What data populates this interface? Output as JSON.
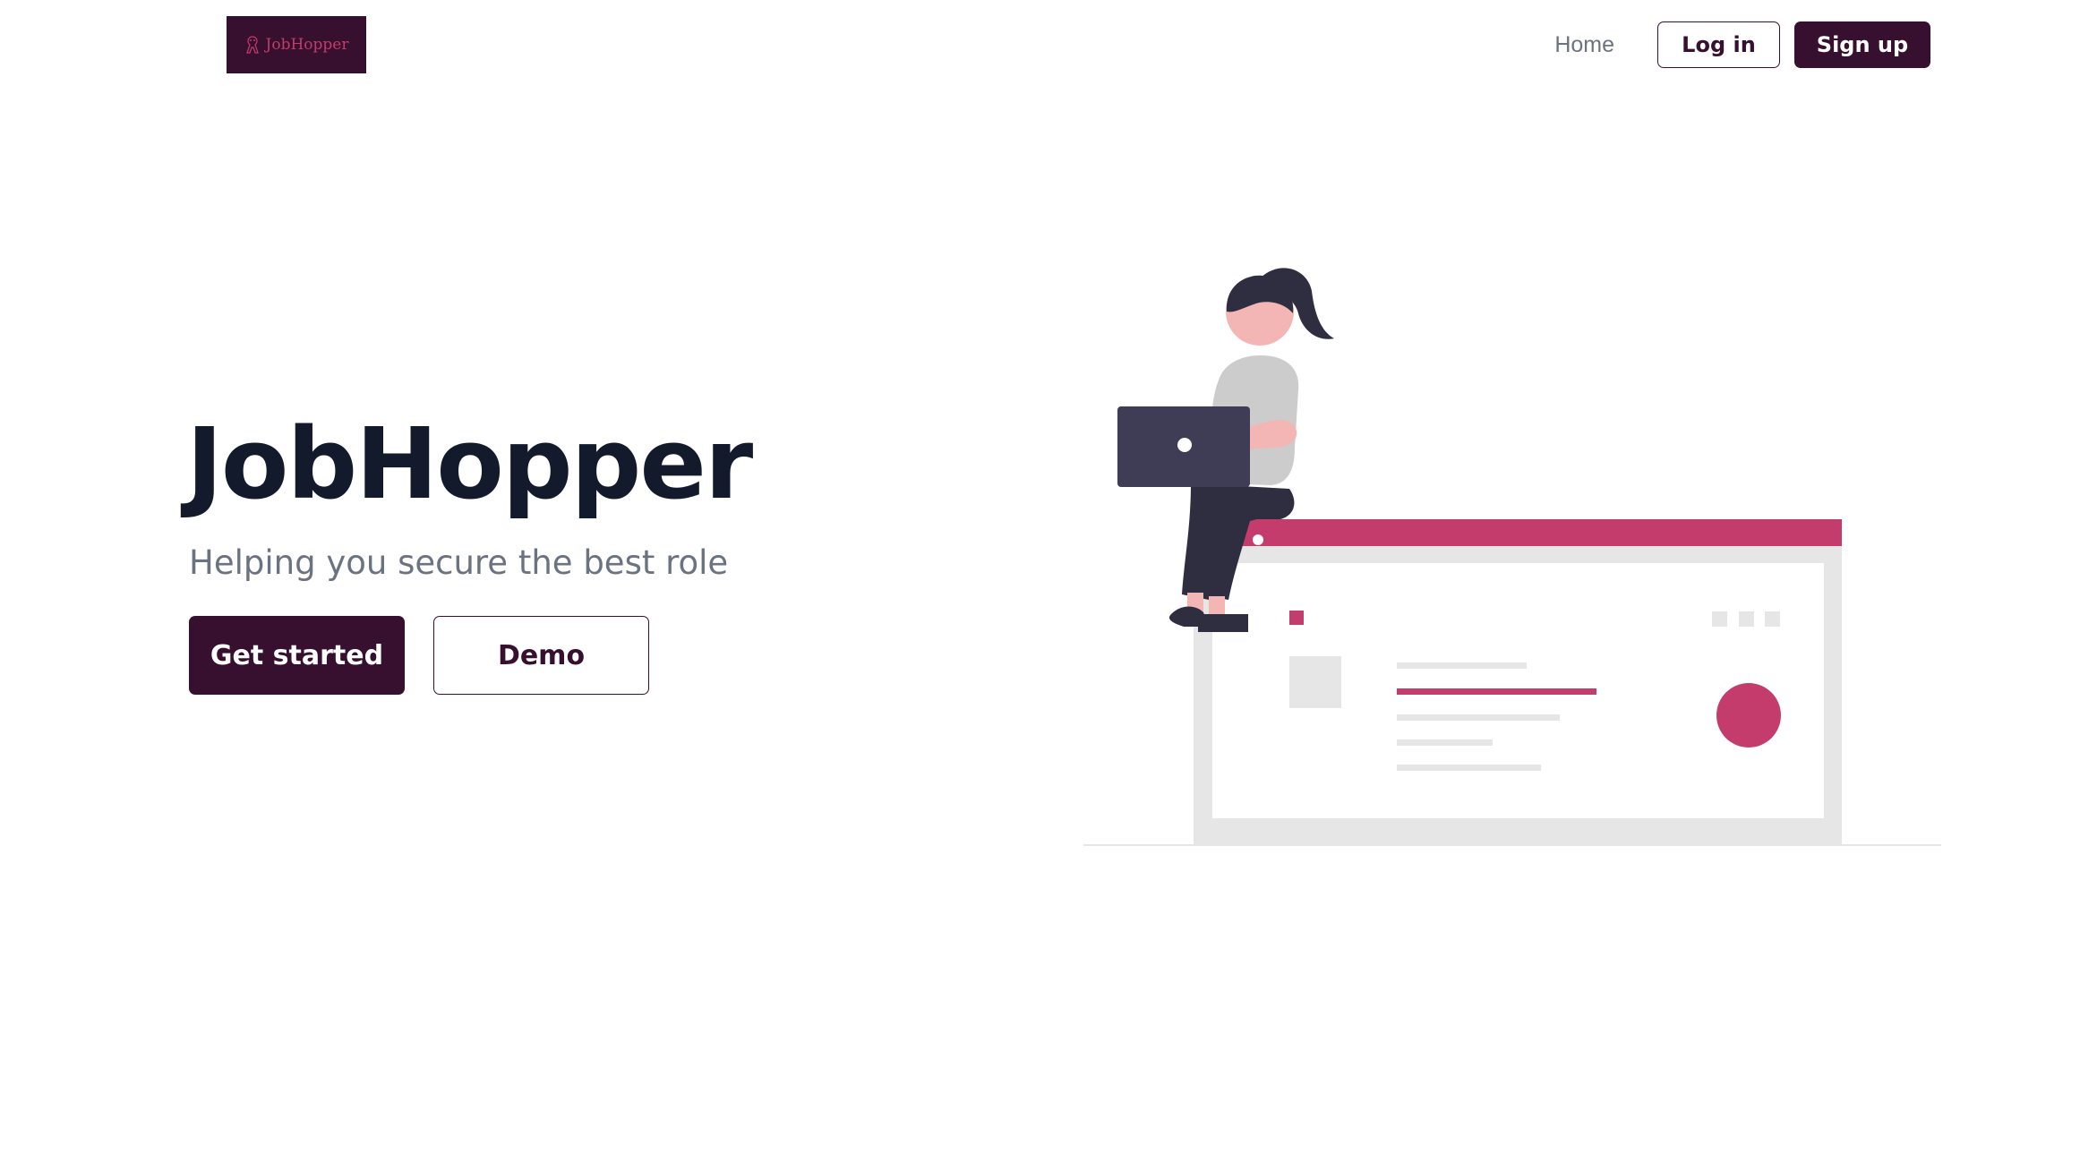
{
  "header": {
    "logo_text": "JobHopper",
    "nav_home": "Home",
    "login_label": "Log in",
    "signup_label": "Sign up"
  },
  "hero": {
    "title": "JobHopper",
    "subtitle": "Helping you secure the best role",
    "primary_cta": "Get started",
    "secondary_cta": "Demo"
  },
  "colors": {
    "brand_dark": "#36102e",
    "accent_pink": "#c33c6b",
    "title_text": "#131a2b",
    "muted_text": "#6b7280"
  },
  "illustration": {
    "icon": "woman-sitting-on-browser-window-illustration"
  }
}
